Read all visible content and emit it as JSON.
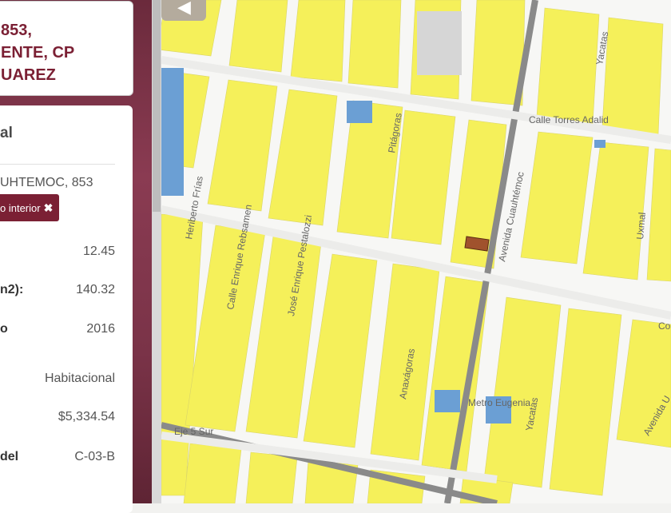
{
  "address_card": {
    "lines": "853,\nENTE, CP\nUAREZ"
  },
  "info_card": {
    "title": "al",
    "address": "UHTEMOC, 853",
    "filter_chip": "o interior",
    "rows": [
      {
        "label": "",
        "value": "12.45"
      },
      {
        "label": "n2):",
        "value": "140.32"
      },
      {
        "label": "o",
        "value": "2016"
      },
      {
        "label": "",
        "value": "Habitacional"
      },
      {
        "label": "",
        "value": "$5,334.54"
      },
      {
        "label": "del",
        "value": "C-03-B"
      }
    ]
  },
  "map": {
    "streets": {
      "calle_torres_adalid": "Calle Torres Adalid",
      "yacatas_top": "Yacatas",
      "uxmal": "Uxmal",
      "pitagoras": "Pitágoras",
      "heriberto_frias": "Heriberto Frías",
      "calle_enrique_rebsamen": "Calle Enrique Rebsamen",
      "jose_enrique_pestalozzi": "José Enrique Pestalozzi",
      "avenida_cuauhtemoc": "Avenida Cuauhtémoc",
      "anaxagoras": "Anaxágoras",
      "yacatas_bottom": "Yacatas",
      "metro_eugenia": "Metro Eugenia",
      "eje_5_sur": "Eje 5 Sur",
      "co": "Co",
      "avenida_u": "Avenida U",
      "avenida_left": "Avenida"
    },
    "colors": {
      "block": "#f5f05a",
      "street": "#f7f7f5",
      "highlight": "#a0522d",
      "water_blue": "#6b9fd4",
      "avenue": "#8a8a8a"
    }
  }
}
